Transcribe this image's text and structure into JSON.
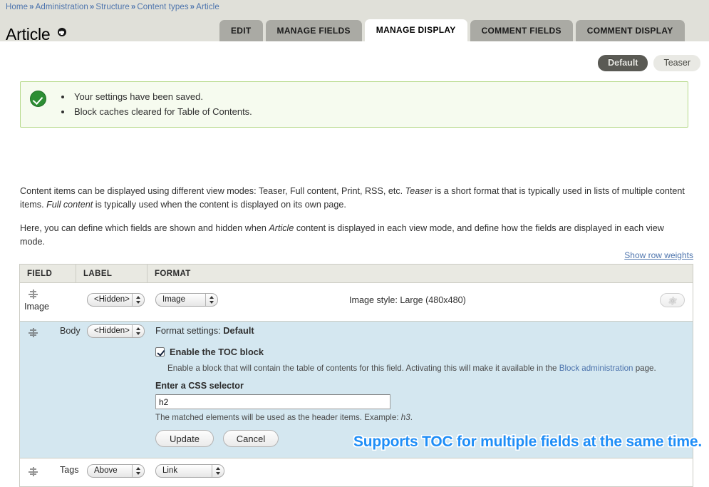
{
  "breadcrumb": {
    "items": [
      "Home",
      "Administration",
      "Structure",
      "Content types",
      "Article"
    ],
    "separator": "»"
  },
  "page": {
    "title": "Article",
    "help_icon": "help-circle-icon"
  },
  "tabs": [
    {
      "label": "EDIT",
      "active": false
    },
    {
      "label": "MANAGE FIELDS",
      "active": false
    },
    {
      "label": "MANAGE DISPLAY",
      "active": true
    },
    {
      "label": "COMMENT FIELDS",
      "active": false
    },
    {
      "label": "COMMENT DISPLAY",
      "active": false
    }
  ],
  "view_modes": [
    {
      "label": "Default",
      "selected": true
    },
    {
      "label": "Teaser",
      "selected": false
    }
  ],
  "status": {
    "icon": "check-circle-icon",
    "messages": [
      "Your settings have been saved.",
      "Block caches cleared for Table of Contents."
    ]
  },
  "intro": {
    "paragraph1_part1": "Content items can be displayed using different view modes: Teaser, Full content, Print, RSS, etc. ",
    "paragraph1_em1": "Teaser",
    "paragraph1_part2": " is a short format that is typically used in lists of multiple content items. ",
    "paragraph1_em2": "Full content",
    "paragraph1_part3": " is typically used when the content is displayed on its own page.",
    "paragraph2_part1": "Here, you can define which fields are shown and hidden when ",
    "paragraph2_em1": "Article",
    "paragraph2_part2": " content is displayed in each view mode, and define how the fields are displayed in each view mode."
  },
  "show_row_weights": "Show row weights",
  "table": {
    "columns": [
      "FIELD",
      "LABEL",
      "FORMAT"
    ],
    "rows": [
      {
        "field": "Image",
        "label_select": "<Hidden>",
        "format_select": "Image",
        "summary": "Image style: Large (480x480)",
        "settings_icon": "gear-icon",
        "highlighted": false
      },
      {
        "field": "Body",
        "label_select": "<Hidden>",
        "format_settings_prefix": "Format settings: ",
        "format_settings_value": "Default",
        "highlighted": true,
        "form": {
          "checkbox_label": "Enable the TOC block",
          "checkbox_checked": true,
          "checkbox_description_part1": "Enable a block that will contain the table of contents for this field. Activating this will make it available in the ",
          "checkbox_description_link": "Block administration",
          "checkbox_description_part2": " page.",
          "css_selector_label": "Enter a CSS selector",
          "css_selector_value": "h2",
          "css_selector_placeholder": "",
          "css_selector_description_part1": "The matched elements will be used as the header items. Example: ",
          "css_selector_description_em": "h3",
          "css_selector_description_part2": ".",
          "update_button": "Update",
          "cancel_button": "Cancel"
        }
      },
      {
        "field": "Tags",
        "label_select": "Above",
        "format_select": "Link",
        "highlighted": false
      }
    ]
  },
  "overlay": {
    "text": "Supports TOC for multiple fields at the same time."
  },
  "colors": {
    "header_band": "#e0e0d9",
    "tab_inactive": "#aaaaa4",
    "tab_active": "#ffffff",
    "link": "#4d74ad",
    "status_bg": "#f6fbef",
    "status_border": "#b6d98b",
    "status_icon": "#2d8e34",
    "row_highlight": "#d4e7f0",
    "overlay_blue": "#1f8ef7"
  }
}
